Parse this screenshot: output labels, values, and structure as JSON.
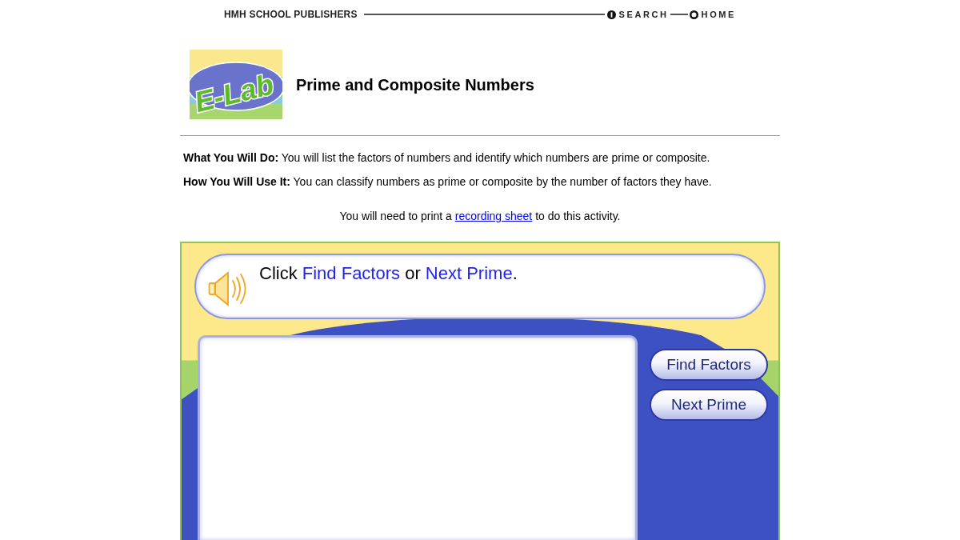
{
  "header": {
    "publisher": "HMH SCHOOL PUBLISHERS",
    "links": [
      {
        "label": "SEARCH",
        "kind": "search"
      },
      {
        "label": "HOME",
        "kind": "home"
      }
    ]
  },
  "logo": {
    "text": "E-Lab"
  },
  "title": "Prime and Composite Numbers",
  "intro": [
    "**What You Will Do:** You will list the factors of numbers and identify which numbers are prime or composite.",
    "**How You Will Use It:** You can classify numbers as prime or composite by the number of factors they have."
  ],
  "print_note": {
    "before": "You will need to print a",
    "link": "recording sheet",
    "after": "to do this activity."
  },
  "activity": {
    "instruction": [
      {
        "text": "Click ",
        "highlight": false
      },
      {
        "text": "Find Factors",
        "highlight": true
      },
      {
        "text": " or ",
        "highlight": false
      },
      {
        "text": "Next Prime",
        "highlight": true
      },
      {
        "text": ".",
        "highlight": false
      }
    ],
    "buttons": [
      "Find Factors",
      "Next Prime"
    ]
  }
}
